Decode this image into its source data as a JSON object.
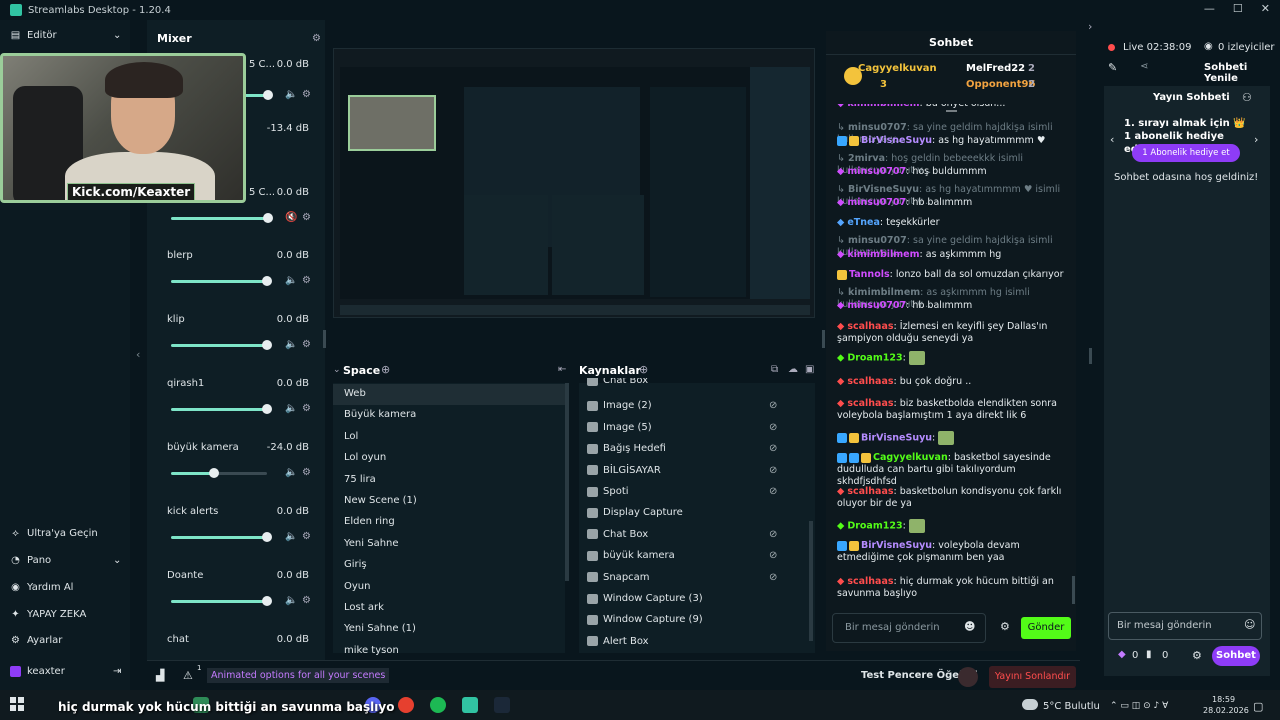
{
  "window": {
    "title": "Streamlabs Desktop - 1.20.4"
  },
  "leftnav": {
    "editor": "Editör",
    "items": [
      {
        "label": "Ultra'ya Geçin",
        "icon": "ultra-icon"
      },
      {
        "label": "Pano",
        "icon": "dashboard-icon"
      },
      {
        "label": "Yardım Al",
        "icon": "help-icon"
      },
      {
        "label": "YAPAY ZEKA",
        "icon": "ai-icon"
      },
      {
        "label": "Ayarlar",
        "icon": "settings-icon"
      }
    ],
    "user": "keaxter"
  },
  "webcam": {
    "caption": "Kick.com/Keaxter"
  },
  "mixer": {
    "title": "Mixer",
    "partial": [
      {
        "name": "5 C...",
        "db": "0.0 dB"
      },
      {
        "name": "",
        "db": "-13.4 dB"
      },
      {
        "name": "5 C...",
        "db": "0.0 dB"
      }
    ],
    "channels": [
      {
        "name": "blerp",
        "db": "0.0 dB",
        "level": 1.0
      },
      {
        "name": "klip",
        "db": "0.0 dB",
        "level": 1.0
      },
      {
        "name": "qirash1",
        "db": "0.0 dB",
        "level": 1.0
      },
      {
        "name": "büyük kamera",
        "db": "-24.0 dB",
        "level": 0.45
      },
      {
        "name": "kick alerts",
        "db": "0.0 dB",
        "level": 1.0
      },
      {
        "name": "Doante",
        "db": "0.0 dB",
        "level": 1.0
      },
      {
        "name": "chat",
        "db": "0.0 dB",
        "level": 1.0
      }
    ]
  },
  "scenes": {
    "title": "Space",
    "items": [
      "Web",
      "Büyük kamera",
      "Lol",
      "Lol oyun",
      "75 lira",
      "New Scene (1)",
      "Elden ring",
      "Yeni Sahne",
      "Giriş",
      "Oyun",
      "Lost ark",
      "Yeni Sahne (1)",
      "mike tyson"
    ],
    "selected": 0
  },
  "sources": {
    "title": "Kaynaklar",
    "items": [
      {
        "label": "Chat Box",
        "eye": false
      },
      {
        "label": "Image (2)",
        "eye": true
      },
      {
        "label": "Image (5)",
        "eye": true
      },
      {
        "label": "Bağış Hedefi",
        "eye": true
      },
      {
        "label": "BİLGİSAYAR",
        "eye": true
      },
      {
        "label": "Spoti",
        "eye": true
      },
      {
        "label": "Display Capture",
        "eye": false
      },
      {
        "label": "Chat Box",
        "eye": true
      },
      {
        "label": "büyük kamera",
        "eye": true
      },
      {
        "label": "Snapcam",
        "eye": true
      },
      {
        "label": "Window Capture (3)",
        "eye": false
      },
      {
        "label": "Window Capture (9)",
        "eye": false
      },
      {
        "label": "Alert Box",
        "eye": false
      }
    ]
  },
  "chat": {
    "title": "Sohbet",
    "top3": [
      {
        "name": "Cagyyelkuvan",
        "count": "3",
        "color": "#f3c33c"
      },
      {
        "name": "MelFred22",
        "count": "2",
        "color": "#ffffff"
      },
      {
        "name": "Opponent96",
        "count": "2",
        "color": "#f2a340"
      }
    ],
    "messages": [
      {
        "user": "kimimbilmem",
        "text": "bu öhyet olsun...",
        "color": "#d04cff",
        "dim": false,
        "cut": true
      },
      {
        "user": "minsu0707",
        "text": "sa yine geldim hajdkişa isimli kullanıcıya y...",
        "color": "#6d7d85",
        "dim": true
      },
      {
        "user": "BirVisneSuyu",
        "text": "as hg hayatımmmm ♥",
        "color": "#b58cff",
        "dim": false
      },
      {
        "user": "2mirva",
        "text": "hoş geldin bebeeekkk isimli kullanıcıya yanıt v...",
        "color": "#6d7d85",
        "dim": true
      },
      {
        "user": "minsu0707",
        "text": "hoş buldummm",
        "color": "#d04cff",
        "dim": false
      },
      {
        "user": "BirVisneSuyu",
        "text": "as hg hayatımmmm ♥ isimli kullanıcıya yanıt v...",
        "color": "#6d7d85",
        "dim": true
      },
      {
        "user": "minsu0707",
        "text": "hb balımmm",
        "color": "#d04cff",
        "dim": false
      },
      {
        "user": "eTnea",
        "text": "teşekkürler",
        "color": "#55a6ff",
        "dim": false
      },
      {
        "user": "minsu0707",
        "text": "sa yine geldim hajdkişa isimli kullanıcıya y...",
        "color": "#6d7d85",
        "dim": true
      },
      {
        "user": "kimimbilmem",
        "text": "as aşkımmm hg",
        "color": "#d04cff",
        "dim": false
      },
      {
        "user": "Tannols",
        "text": "lonzo ball da sol omuzdan çıkarıyor",
        "color": "#d04cff",
        "dim": false
      },
      {
        "user": "kimimbilmem",
        "text": "as aşkımmm hg isimli kullanıcıya yanıt v...",
        "color": "#6d7d85",
        "dim": true
      },
      {
        "user": "minsu0707",
        "text": "hb balımmm",
        "color": "#d04cff",
        "dim": false
      },
      {
        "user": "scalhaas",
        "text": "İzlemesi en keyifli şey Dallas'ın şampiyon olduğu seneydi ya",
        "color": "#ff4d4d",
        "dim": false
      },
      {
        "user": "Droam123",
        "text": "",
        "color": "#53fc18",
        "dim": false
      },
      {
        "user": "scalhaas",
        "text": "bu çok doğru ..",
        "color": "#ff4d4d",
        "dim": false
      },
      {
        "user": "scalhaas",
        "text": "biz basketbolda elendikten sonra voleybola başlamıştım 1 aya direkt lik 6",
        "color": "#ff4d4d",
        "dim": false
      },
      {
        "user": "BirVisneSuyu",
        "text": "",
        "color": "#b58cff",
        "dim": false
      },
      {
        "user": "Cagyyelkuvan",
        "text": "basketbol sayesinde dudulluda can bartu gibi takılıyordum skhdfjsdhfsd",
        "color": "#53fc18",
        "dim": false
      },
      {
        "user": "scalhaas",
        "text": "basketbolun kondisyonu çok farklı oluyor bir de ya",
        "color": "#ff4d4d",
        "dim": false
      },
      {
        "user": "Droam123",
        "text": "",
        "color": "#53fc18",
        "dim": false
      },
      {
        "user": "BirVisneSuyu",
        "text": "voleybola devam etmediğime çok pişmanım ben yaa",
        "color": "#b58cff",
        "dim": false
      },
      {
        "user": "scalhaas",
        "text": "hiç durmak yok hücum bittiği an savunma başlıyo",
        "color": "#ff4d4d",
        "dim": false
      }
    ],
    "input_placeholder": "Bir mesaj gönderin",
    "send": "Gönder"
  },
  "rightpanel": {
    "live": "Live 02:38:09",
    "viewers": "0 izleyiciler",
    "refresh": "Sohbeti Yenile",
    "stream_chat": "Yayın Sohbeti",
    "promo": "1. sırayı almak için 👑 1 abonelik hediye edin.",
    "gift_button": "1 Abonelik hediye et",
    "welcome": "Sohbet odasına hoş geldiniz!",
    "input_placeholder": "Bir mesaj gönderin",
    "count1": "0",
    "count2": "0",
    "send": "Sohbet"
  },
  "statusbar": {
    "notice_count": "1",
    "notice": "Animated options for all your scenes",
    "test": "Test Pencere Öğeleri",
    "end": "Yayını Sonlandır"
  },
  "taskbar": {
    "subtitle": "hiç durmak yok hücum bittiği an savunma başlıyo",
    "weather": "5°C  Bulutlu",
    "time": "18:59",
    "date": "28.02.2026"
  },
  "colors": {
    "accent": "#31c3a2",
    "kick": "#53fc18",
    "purple": "#8e3cf7",
    "end": "#ff4d4d"
  }
}
